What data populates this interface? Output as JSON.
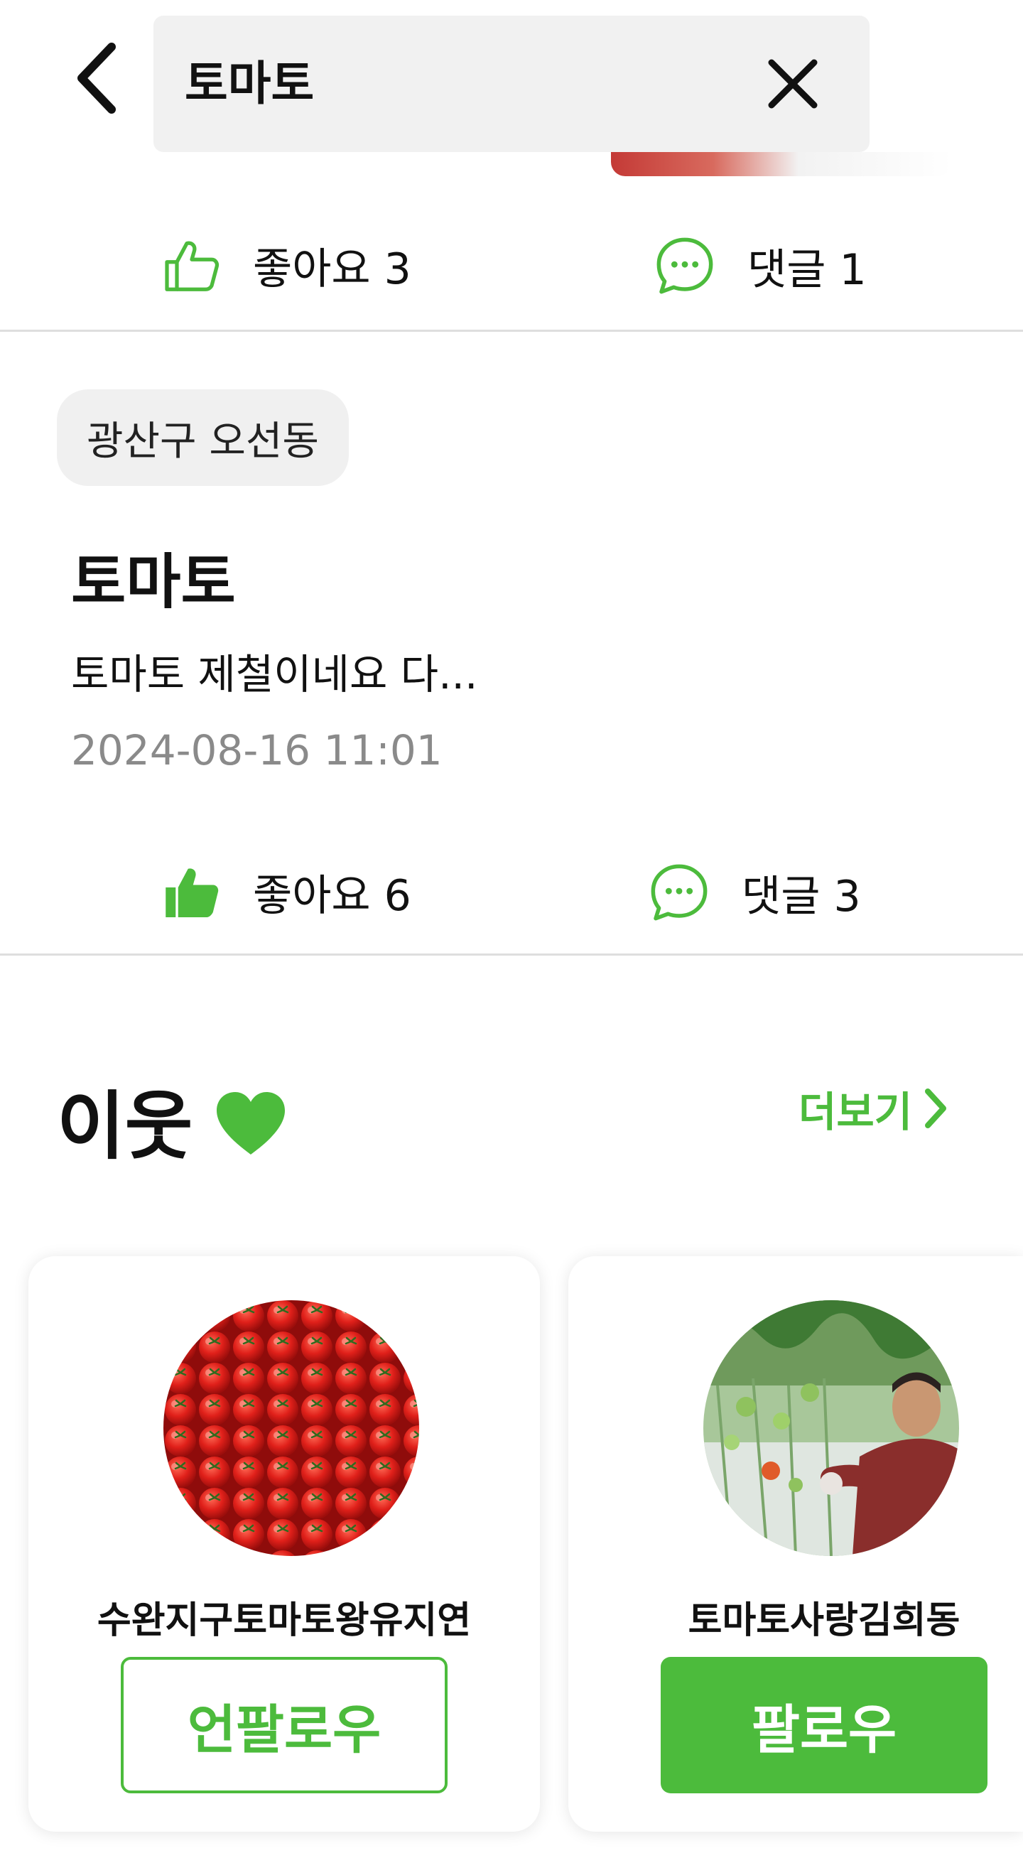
{
  "search": {
    "query": "토마토"
  },
  "colors": {
    "accent": "#4cbb3c",
    "chip_bg": "#f0f0f0",
    "search_bg": "#f1f1f1",
    "date": "#8a8a8a"
  },
  "icons": {
    "back": "chevron-left-icon",
    "clear": "close-icon",
    "like_outline": "thumbs-up-outline-icon",
    "like_filled": "thumbs-up-filled-icon",
    "comment": "chat-bubble-icon",
    "heart": "heart-icon",
    "more": "chevron-right-icon"
  },
  "prev_post_actions": {
    "like_label": "좋아요 3",
    "comment_label": "댓글 1"
  },
  "post": {
    "location": "광산구 오선동",
    "title": "토마토",
    "body": "토마토 제철이네요 다...",
    "date": "2024-08-16 11:01",
    "like_label": "좋아요 6",
    "comment_label": "댓글 3",
    "liked": true
  },
  "neighbors": {
    "title": "이웃",
    "more_label": "더보기",
    "cards": [
      {
        "name": "수완지구토마토왕유지연",
        "button_label": "언팔로우",
        "following": true
      },
      {
        "name": "토마토사랑김희동",
        "button_label": "팔로우",
        "following": false
      }
    ]
  }
}
